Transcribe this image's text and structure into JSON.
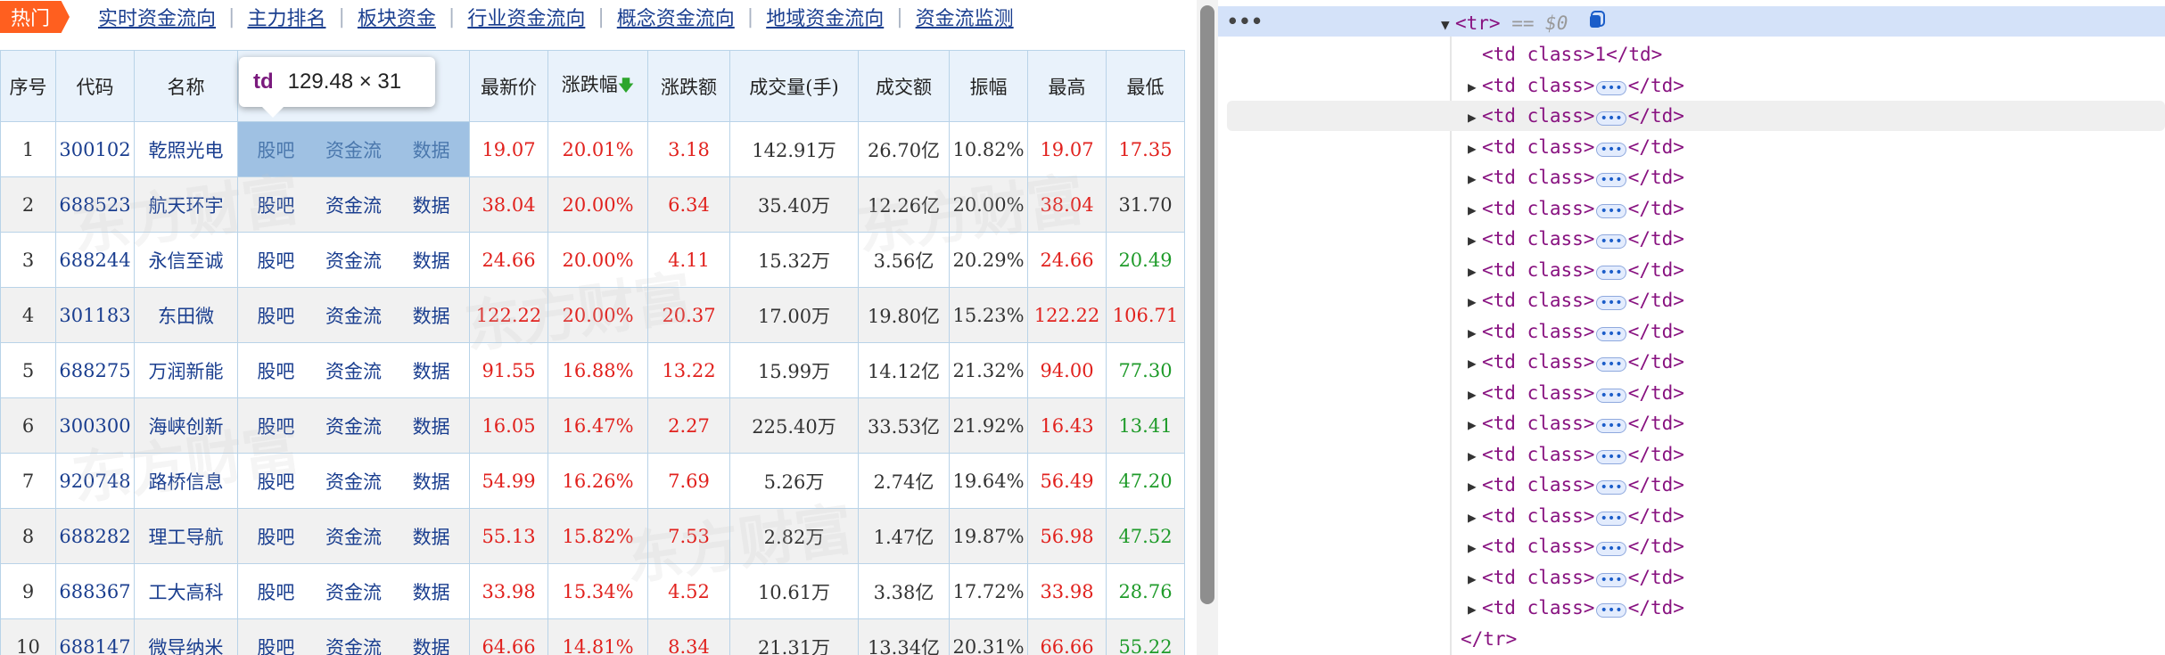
{
  "nav": {
    "hot": "热门",
    "links": [
      "实时资金流向",
      "主力排名",
      "板块资金",
      "行业资金流向",
      "概念资金流向",
      "地域资金流向",
      "资金流监测"
    ]
  },
  "table": {
    "headers": [
      "序号",
      "代码",
      "名称",
      "",
      "最新价",
      "涨跌幅",
      "涨跌额",
      "成交量(手)",
      "成交额",
      "振幅",
      "最高",
      "最低"
    ],
    "link_labels": [
      "股吧",
      "资金流",
      "数据"
    ],
    "rows": [
      {
        "idx": "1",
        "code": "300102",
        "name": "乾照光电",
        "price": "19.07",
        "pct": "20.01%",
        "chg": "3.18",
        "vol": "142.91万",
        "amt": "26.70亿",
        "amp": "10.82%",
        "high": "19.07",
        "low": "17.35",
        "low_color": "red"
      },
      {
        "idx": "2",
        "code": "688523",
        "name": "航天环宇",
        "price": "38.04",
        "pct": "20.00%",
        "chg": "6.34",
        "vol": "35.40万",
        "amt": "12.26亿",
        "amp": "20.00%",
        "high": "38.04",
        "low": "31.70",
        "low_color": "dark"
      },
      {
        "idx": "3",
        "code": "688244",
        "name": "永信至诚",
        "price": "24.66",
        "pct": "20.00%",
        "chg": "4.11",
        "vol": "15.32万",
        "amt": "3.56亿",
        "amp": "20.29%",
        "high": "24.66",
        "low": "20.49",
        "low_color": "green"
      },
      {
        "idx": "4",
        "code": "301183",
        "name": "东田微",
        "price": "122.22",
        "pct": "20.00%",
        "chg": "20.37",
        "vol": "17.00万",
        "amt": "19.80亿",
        "amp": "15.23%",
        "high": "122.22",
        "low": "106.71",
        "low_color": "red"
      },
      {
        "idx": "5",
        "code": "688275",
        "name": "万润新能",
        "price": "91.55",
        "pct": "16.88%",
        "chg": "13.22",
        "vol": "15.99万",
        "amt": "14.12亿",
        "amp": "21.32%",
        "high": "94.00",
        "low": "77.30",
        "low_color": "green"
      },
      {
        "idx": "6",
        "code": "300300",
        "name": "海峡创新",
        "price": "16.05",
        "pct": "16.47%",
        "chg": "2.27",
        "vol": "225.40万",
        "amt": "33.53亿",
        "amp": "21.92%",
        "high": "16.43",
        "low": "13.41",
        "low_color": "green"
      },
      {
        "idx": "7",
        "code": "920748",
        "name": "路桥信息",
        "price": "54.99",
        "pct": "16.26%",
        "chg": "7.69",
        "vol": "5.26万",
        "amt": "2.74亿",
        "amp": "19.64%",
        "high": "56.49",
        "low": "47.20",
        "low_color": "green"
      },
      {
        "idx": "8",
        "code": "688282",
        "name": "理工导航",
        "price": "55.13",
        "pct": "15.82%",
        "chg": "7.53",
        "vol": "2.82万",
        "amt": "1.47亿",
        "amp": "19.87%",
        "high": "56.98",
        "low": "47.52",
        "low_color": "green"
      },
      {
        "idx": "9",
        "code": "688367",
        "name": "工大高科",
        "price": "33.98",
        "pct": "15.34%",
        "chg": "4.52",
        "vol": "10.61万",
        "amt": "3.38亿",
        "amp": "17.72%",
        "high": "33.98",
        "low": "28.76",
        "low_color": "green"
      },
      {
        "idx": "10",
        "code": "688147",
        "name": "微导纳米",
        "price": "64.66",
        "pct": "14.81%",
        "chg": "8.34",
        "vol": "21.31万",
        "amt": "13.34亿",
        "amp": "20.31%",
        "high": "66.66",
        "low": "55.22",
        "low_color": "green"
      }
    ]
  },
  "tooltip": {
    "tag": "td",
    "size": "129.48 × 31"
  },
  "devtools": {
    "dots": "•••",
    "tr_open": "<tr>",
    "eq0": "== $0",
    "td_first": "<td class>1</td>",
    "td_tag_open": "<td class>",
    "td_tag_close": "</td>",
    "ellipsis": "•••",
    "tr_close": "</tr>",
    "td_count": 18
  },
  "colors": {
    "accent_hot": "#ff5f1f",
    "link": "#1a3e8f",
    "up": "#e1221e",
    "down": "#1f9b2a",
    "selected_row_devtools": "#d4e2f9"
  }
}
